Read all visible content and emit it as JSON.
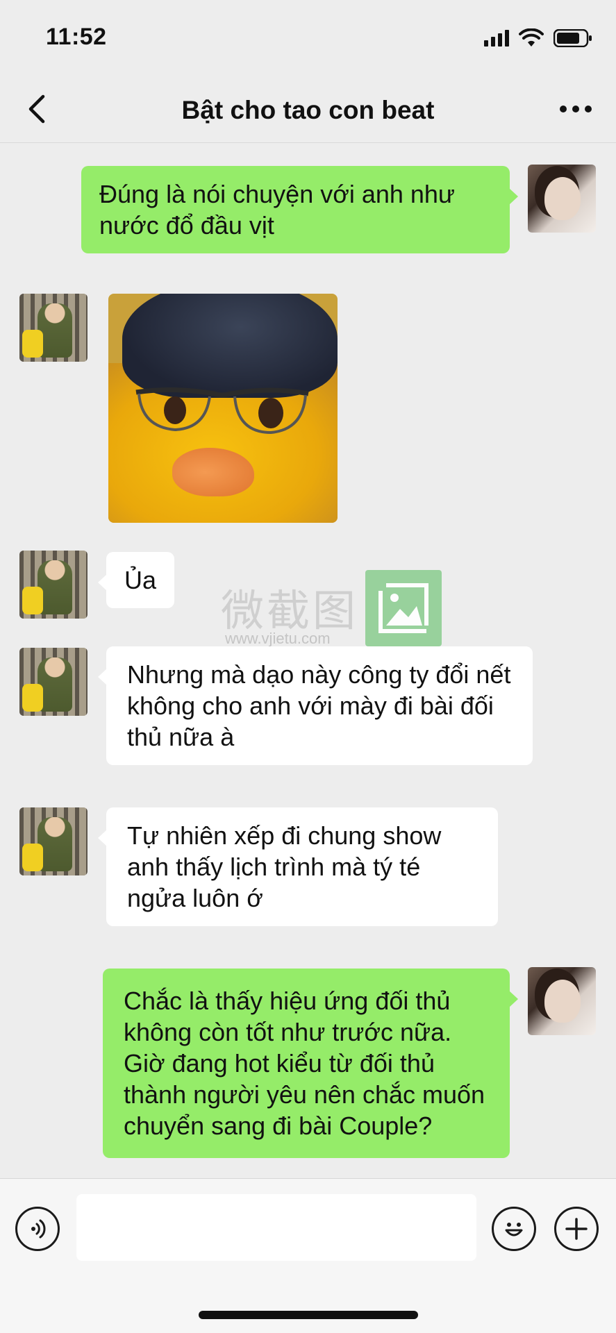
{
  "status_bar": {
    "time": "11:52"
  },
  "nav": {
    "title": "Bật cho tao con beat"
  },
  "messages": [
    {
      "from": "self",
      "text": "Đúng là nói chuyện với anh như nước đổ đầu vịt"
    },
    {
      "from": "other",
      "type": "sticker",
      "icon": "duck-with-glasses-sticker"
    },
    {
      "from": "other",
      "text": "Ủa"
    },
    {
      "from": "other",
      "text": "Nhưng mà dạo này công ty đổi nết không cho anh với mày đi bài đối thủ nữa à"
    },
    {
      "from": "other",
      "text": "Tự nhiên xếp đi chung show anh thấy lịch trình mà tý té ngửa luôn ớ"
    },
    {
      "from": "self",
      "text": "Chắc là thấy hiệu ứng đối thủ không còn tốt như trước nữa. Giờ đang hot kiểu từ đối thủ thành người yêu nên chắc muốn chuyển sang đi bài Couple?"
    }
  ],
  "watermark": {
    "text": "微截图",
    "url": "www.vjietu.com"
  },
  "input": {
    "value": "",
    "placeholder": ""
  },
  "colors": {
    "self_bubble": "#95ec69",
    "other_bubble": "#ffffff",
    "background": "#ededed"
  }
}
